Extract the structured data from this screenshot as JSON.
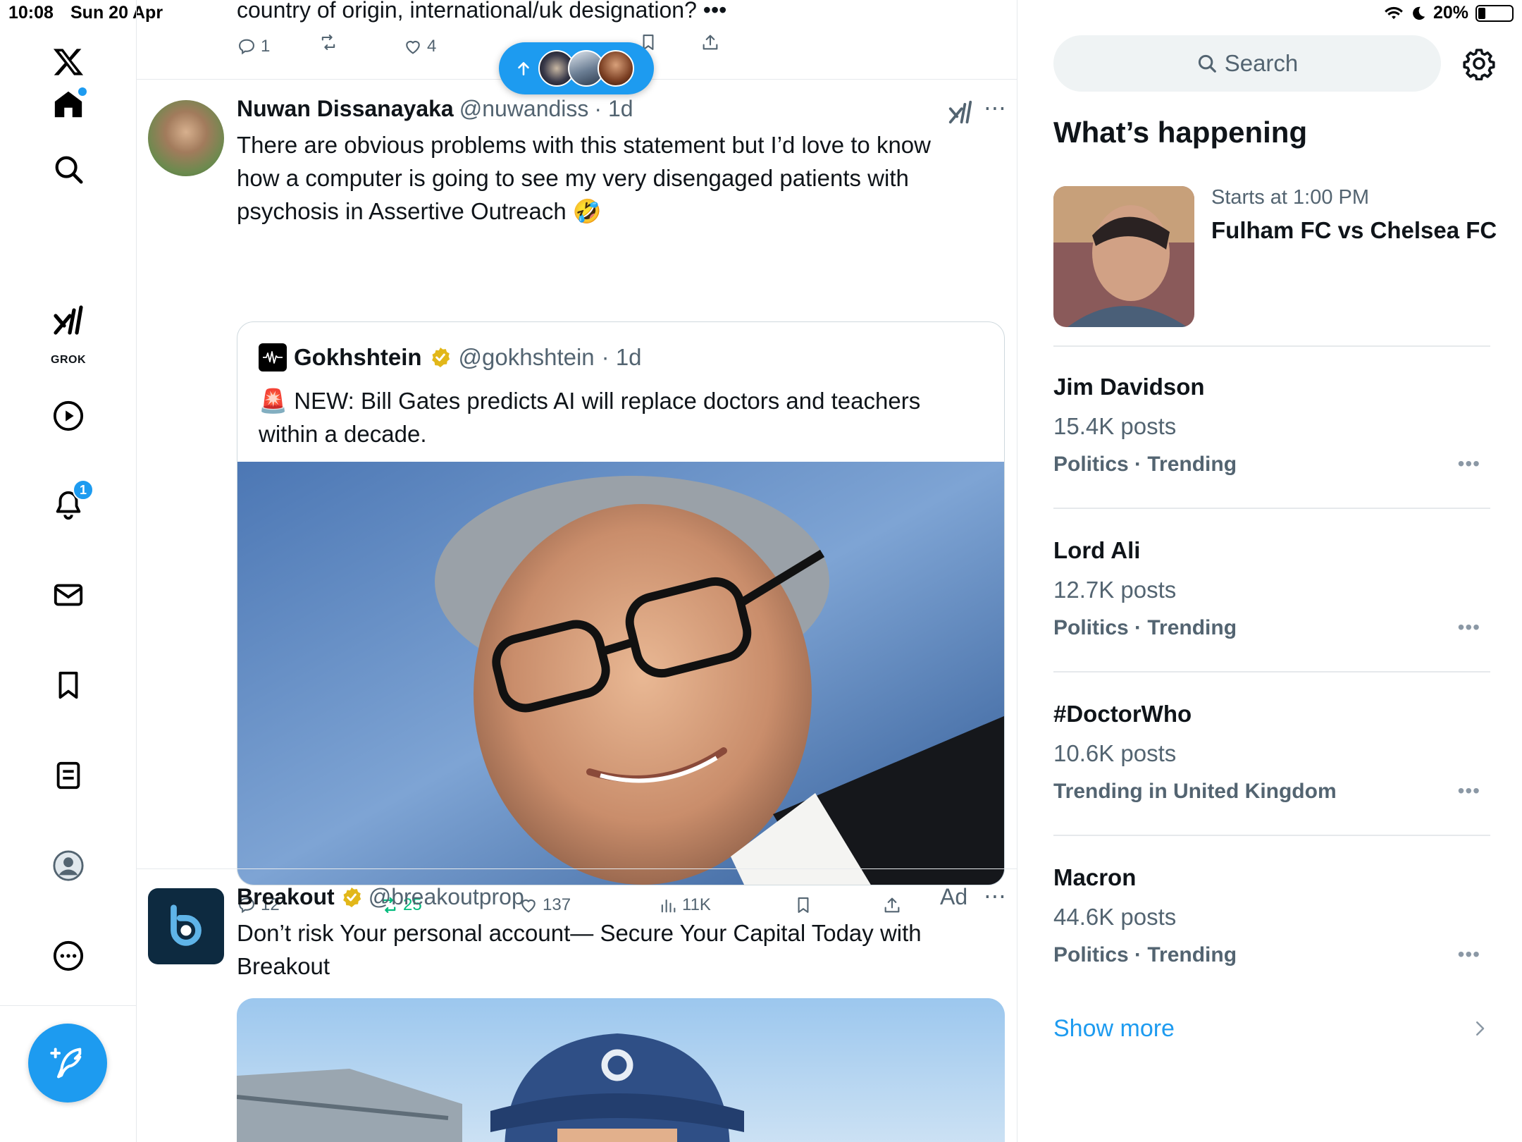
{
  "status_bar": {
    "time": "10:08",
    "date": "Sun 20 Apr",
    "battery": "20%",
    "battery_level": 0.2
  },
  "nav": {
    "grok_label": "GROK",
    "notification_badge": "1"
  },
  "previous_tweet": {
    "text_tail": "country of origin, international/uk designation? •••",
    "replies": "1",
    "likes": "4"
  },
  "tweet1": {
    "name": "Nuwan Dissanayaka",
    "handle": "@nuwandiss",
    "time": "· 1d",
    "text": "There are obvious problems with this statement but I’d love to know how a computer is going to see my very disengaged patients with psychosis in Assertive Outreach 🤣",
    "quote": {
      "name": "Gokhshtein",
      "handle": "@gokhshtein",
      "time": "· 1d",
      "text": "🚨 NEW: Bill Gates predicts AI will replace doctors and teachers within a decade."
    },
    "replies": "12",
    "reposts": "25",
    "likes": "137",
    "views": "11K"
  },
  "tweet2": {
    "name": "Breakout",
    "handle": "@breakoutprop",
    "ad_label": "Ad",
    "text": "Don’t risk Your personal account— Secure Your Capital Today with Breakout"
  },
  "sidebar": {
    "search_placeholder": "Search",
    "title": "What’s happening",
    "event": {
      "meta": "Starts at 1:00 PM",
      "title": "Fulham FC vs Chelsea FC"
    },
    "trends": [
      {
        "name": "Jim Davidson",
        "count": "15.4K posts",
        "category": "Politics · Trending"
      },
      {
        "name": "Lord Ali",
        "count": "12.7K posts",
        "category": "Politics · Trending"
      },
      {
        "name": "#DoctorWho",
        "count": "10.6K posts",
        "category": "Trending in United Kingdom"
      },
      {
        "name": "Macron",
        "count": "44.6K posts",
        "category": "Politics · Trending"
      }
    ],
    "show_more": "Show more"
  },
  "colors": {
    "accent": "#1d9bf0",
    "repost_active": "#00ba7c",
    "muted": "#536471"
  }
}
